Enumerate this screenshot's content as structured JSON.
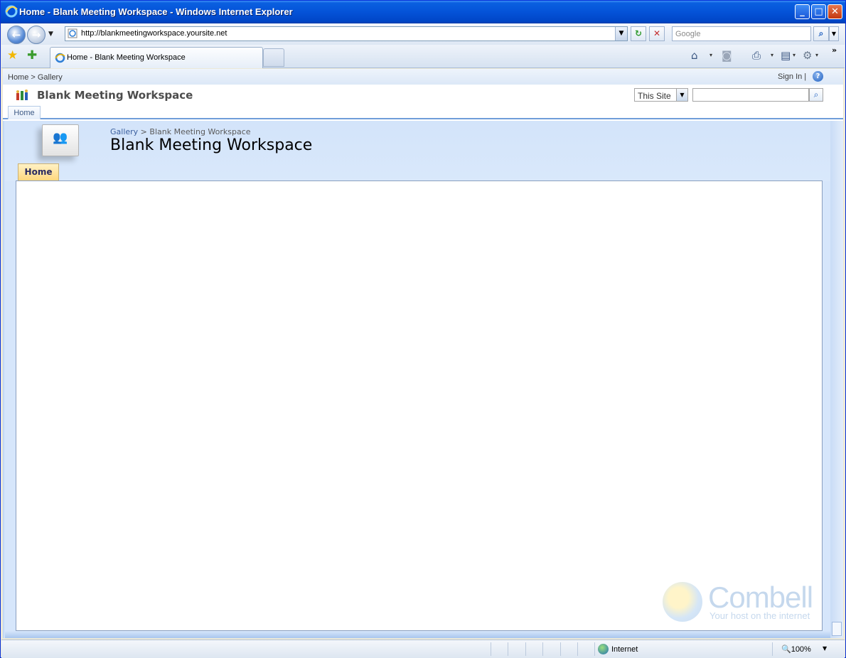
{
  "window": {
    "title": "Home - Blank Meeting Workspace - Windows Internet Explorer",
    "minimize_label": "_",
    "maximize_label": "□",
    "close_label": "✕"
  },
  "navbar": {
    "back_label": "←",
    "forward_label": "→",
    "history_dropdown": "▼",
    "url": "http://blankmeetingworkspace.yoursite.net",
    "url_dropdown": "▼",
    "refresh_label": "↻",
    "stop_label": "✕",
    "search_placeholder": "Google",
    "search_label": "⌕",
    "search_options": "▼",
    "icons": [
      "ie-page-icon",
      "refresh-icon",
      "stop-icon",
      "search-icon"
    ]
  },
  "tabbar": {
    "favorites_star": "★",
    "add_favorites": "✚",
    "active_tab": "Home - Blank Meeting Workspace",
    "more": "»",
    "commands": [
      {
        "name": "home-icon",
        "glyph": "⌂"
      },
      {
        "name": "feeds-icon",
        "glyph": "◙"
      },
      {
        "name": "print-icon",
        "glyph": "⎙"
      },
      {
        "name": "page-icon",
        "glyph": "▤"
      },
      {
        "name": "tools-icon",
        "glyph": "⚙"
      }
    ],
    "dropdown": "▾"
  },
  "sharepoint": {
    "top_breadcrumb": "Home > Gallery",
    "sign_in": "Sign In |",
    "help": "?",
    "site_title": "Blank Meeting Workspace",
    "search_scope": "This Site",
    "search_value": "",
    "search_go": "⌕",
    "top_tab": "Home"
  },
  "workspace": {
    "breadcrumb_link": "Gallery",
    "breadcrumb_rest": " > Blank Meeting Workspace",
    "title": "Blank Meeting Workspace",
    "tab": "Home",
    "icon_glyph": "👥"
  },
  "watermark": {
    "brand": "Combell",
    "tagline": "Your host on the internet"
  },
  "statusbar": {
    "zone": "Internet",
    "zoom": "🔍100%",
    "zoom_dropdown": "▼"
  },
  "colors": {
    "titlebar": "#0453d8",
    "accent": "#6f9dd9",
    "active_tab": "#ffd77d",
    "workspace_bg": "#d6e6fb"
  }
}
